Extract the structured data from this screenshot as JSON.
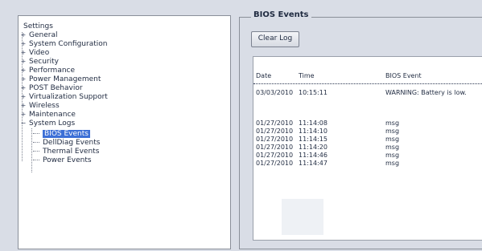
{
  "tree": {
    "root": "Settings",
    "items": [
      {
        "label": "General",
        "toggle": "+"
      },
      {
        "label": "System Configuration",
        "toggle": "+"
      },
      {
        "label": "Video",
        "toggle": "+"
      },
      {
        "label": "Security",
        "toggle": "+"
      },
      {
        "label": "Performance",
        "toggle": "+"
      },
      {
        "label": "Power Management",
        "toggle": "+"
      },
      {
        "label": "POST Behavior",
        "toggle": "+"
      },
      {
        "label": "Virtualization Support",
        "toggle": "+"
      },
      {
        "label": "Wireless",
        "toggle": "+"
      },
      {
        "label": "Maintenance",
        "toggle": "+"
      },
      {
        "label": "System Logs",
        "toggle": "−"
      }
    ],
    "sub_items": [
      {
        "label": "BIOS Events",
        "selected": true
      },
      {
        "label": "DellDiag Events",
        "selected": false
      },
      {
        "label": "Thermal Events",
        "selected": false
      },
      {
        "label": "Power Events",
        "selected": false
      }
    ]
  },
  "events": {
    "group_title": "BIOS Events",
    "clear_button": "Clear Log",
    "columns": {
      "date": "Date",
      "time": "Time",
      "event": "BIOS Event"
    },
    "rows": [
      {
        "date": "03/03/2010",
        "time": "10:15:11",
        "event": "WARNING: Battery is low."
      },
      {
        "date": "01/27/2010",
        "time": "11:14:08",
        "event": "msg"
      },
      {
        "date": "01/27/2010",
        "time": "11:14:10",
        "event": "msg"
      },
      {
        "date": "01/27/2010",
        "time": "11:14:15",
        "event": "msg"
      },
      {
        "date": "01/27/2010",
        "time": "11:14:20",
        "event": "msg"
      },
      {
        "date": "01/27/2010",
        "time": "11:14:46",
        "event": "msg"
      },
      {
        "date": "01/27/2010",
        "time": "11:14:47",
        "event": "msg"
      }
    ]
  },
  "colors": {
    "selection": "#3c6fd6",
    "background": "#d9dde6"
  }
}
